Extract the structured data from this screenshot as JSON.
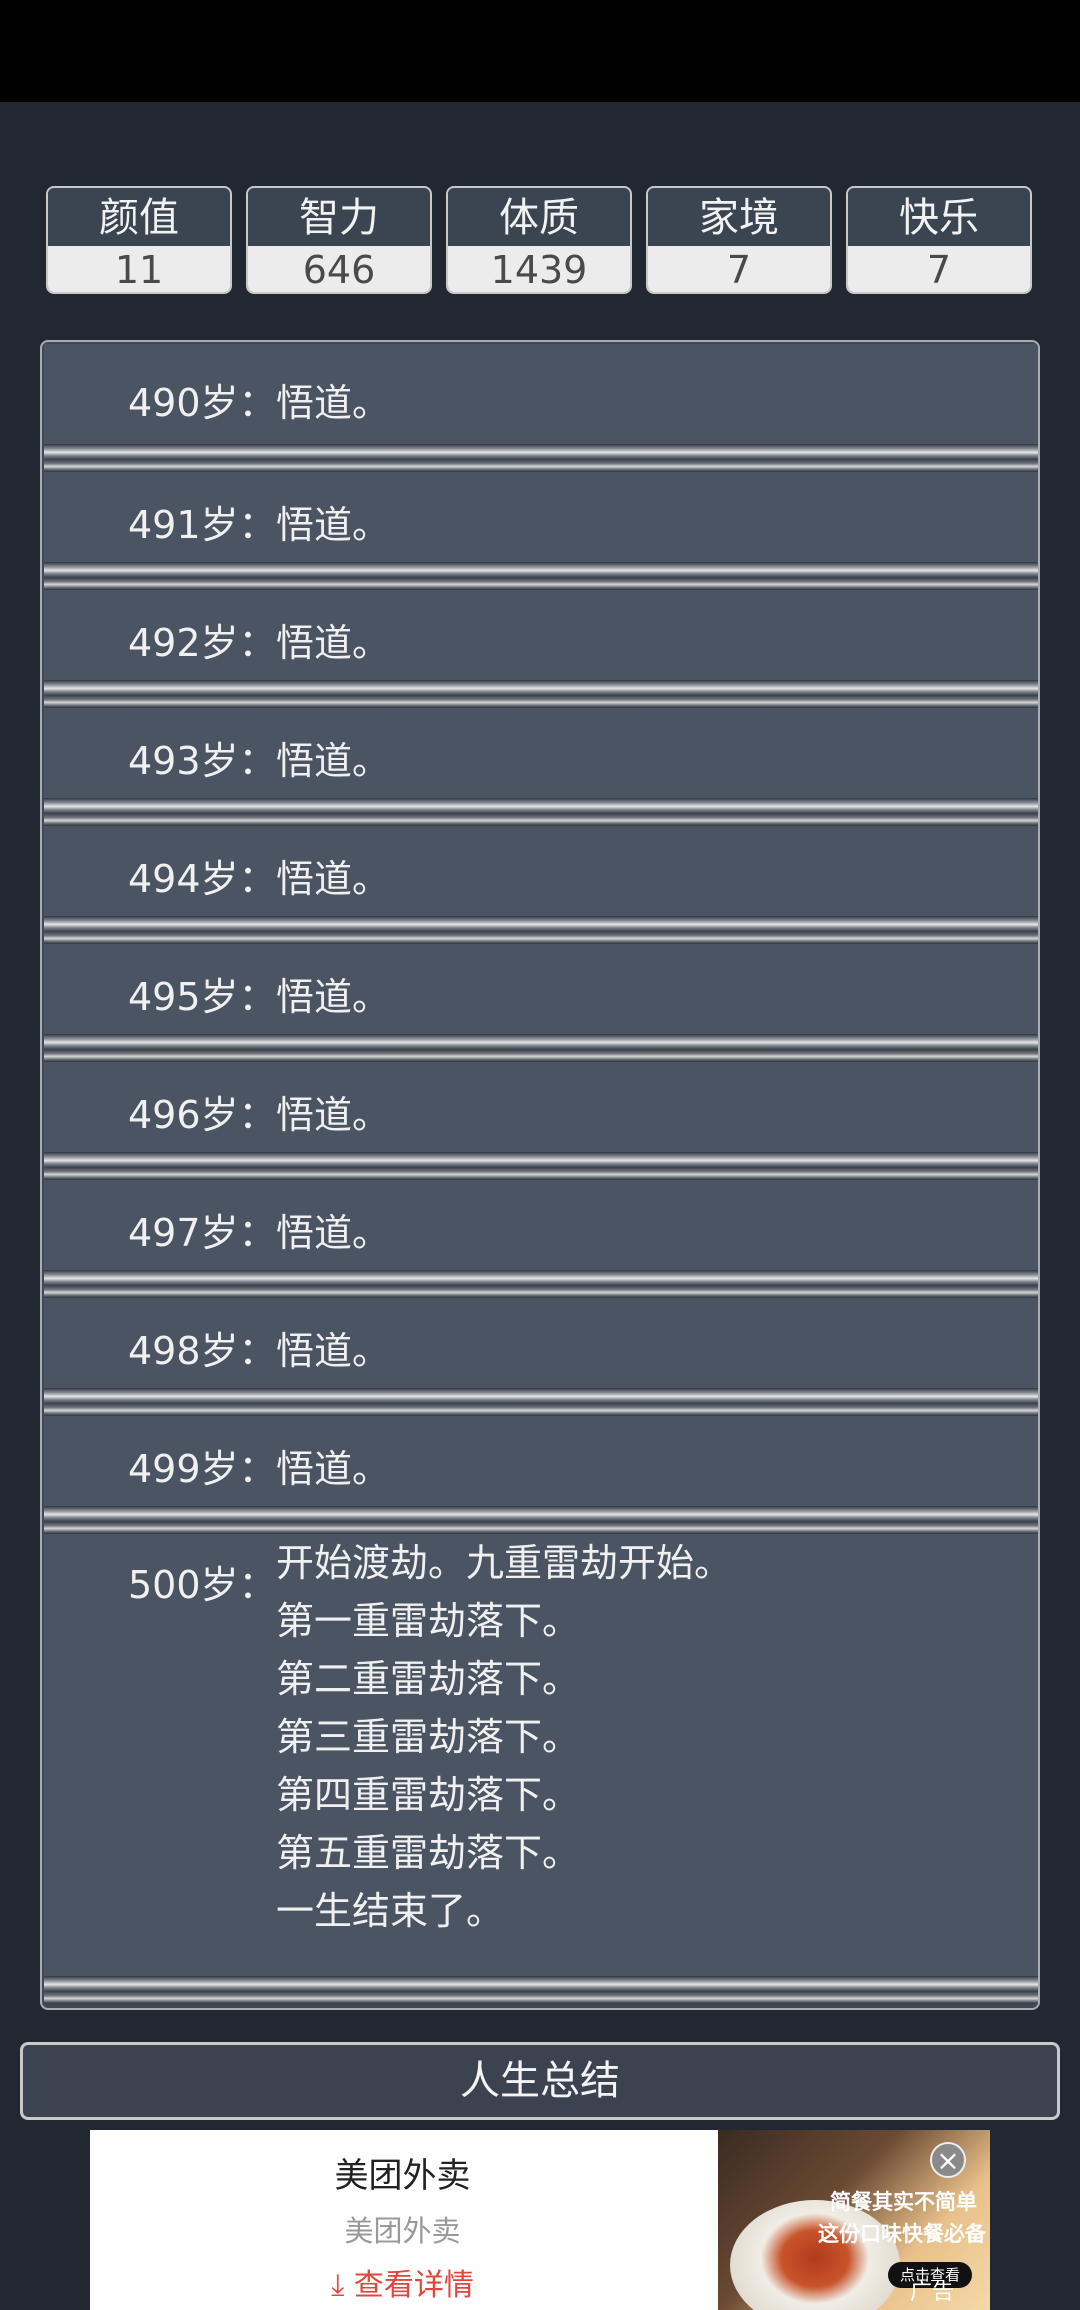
{
  "stats": [
    {
      "label": "颜值",
      "value": "11"
    },
    {
      "label": "智力",
      "value": "646"
    },
    {
      "label": "体质",
      "value": "1439"
    },
    {
      "label": "家境",
      "value": "7"
    },
    {
      "label": "快乐",
      "value": "7"
    }
  ],
  "events": [
    {
      "age": "490岁：",
      "text": "悟道。"
    },
    {
      "age": "491岁：",
      "text": "悟道。"
    },
    {
      "age": "492岁：",
      "text": "悟道。"
    },
    {
      "age": "493岁：",
      "text": "悟道。"
    },
    {
      "age": "494岁：",
      "text": "悟道。"
    },
    {
      "age": "495岁：",
      "text": "悟道。"
    },
    {
      "age": "496岁：",
      "text": "悟道。"
    },
    {
      "age": "497岁：",
      "text": "悟道。"
    },
    {
      "age": "498岁：",
      "text": "悟道。"
    },
    {
      "age": "499岁：",
      "text": "悟道。"
    }
  ],
  "final_event": {
    "age": "500岁：",
    "lines": [
      "开始渡劫。九重雷劫开始。",
      "第一重雷劫落下。",
      "第二重雷劫落下。",
      "第三重雷劫落下。",
      "第四重雷劫落下。",
      "第五重雷劫落下。",
      "一生结束了。"
    ]
  },
  "summary_button": "人生总结",
  "ad": {
    "title": "美团外卖",
    "subtitle": "美团外卖",
    "link_label": "查看详情",
    "image_text_1": "简餐其实不简单",
    "image_text_2": "这份口味快餐必备",
    "image_button": "点击查看",
    "close_icon": "close-icon",
    "tag": "广告"
  }
}
